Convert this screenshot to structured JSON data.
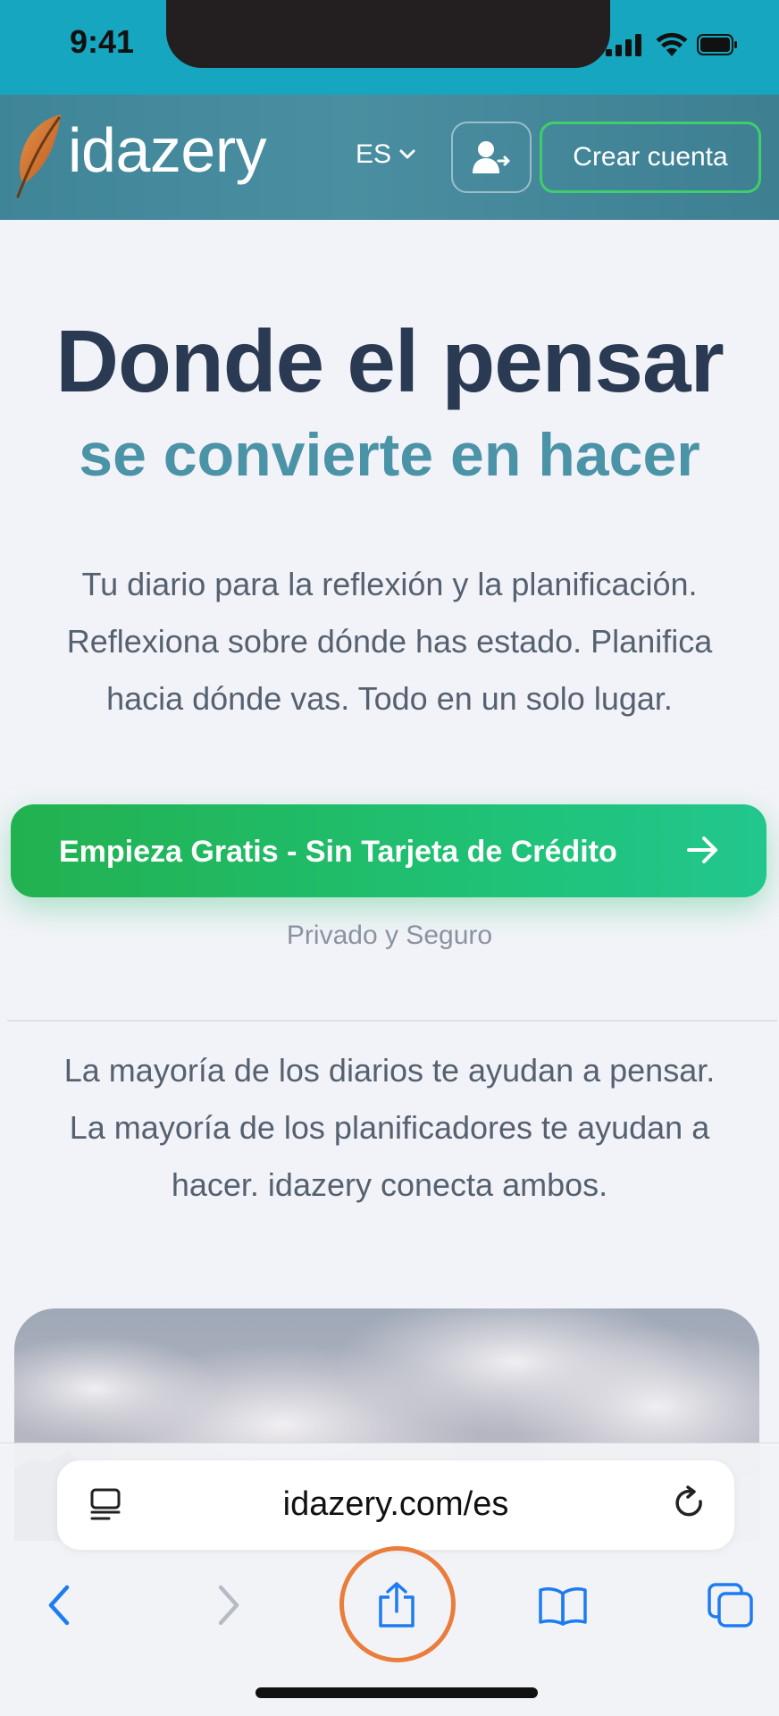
{
  "status_bar": {
    "time": "9:41"
  },
  "header": {
    "logo_text": "idazery",
    "language": "ES",
    "signup_label": "Crear cuenta"
  },
  "hero": {
    "title": "Donde el pensar",
    "subtitle": "se convierte en hacer",
    "description_lines": [
      "Tu diario para la reflexión y la planificación.",
      "Reflexiona sobre dónde has estado. Planifica",
      "hacia dónde vas. Todo en un solo lugar."
    ],
    "cta_label": "Empieza Gratis - Sin Tarjeta de Crédito",
    "privacy_note": "Privado y Seguro"
  },
  "comparison": {
    "lines": [
      "La mayoría de los diarios te ayudan a pensar.",
      "La mayoría de los planificadores te ayudan a",
      "hacer. idazery conecta ambos."
    ]
  },
  "browser": {
    "url": "idazery.com/es",
    "icons": [
      "reader-icon",
      "reload-icon",
      "back-icon",
      "forward-icon",
      "share-icon",
      "bookmarks-icon",
      "tabs-icon"
    ]
  },
  "colors": {
    "status_bar": "#17a6bf",
    "header": "#4a8ea1",
    "title": "#2a3a52",
    "subtitle": "#4b93a6",
    "cta": "#1fc37a",
    "signup_border": "#3fcf6a",
    "safari_blue": "#1e7cf2",
    "highlight": "#ea7d3c"
  }
}
